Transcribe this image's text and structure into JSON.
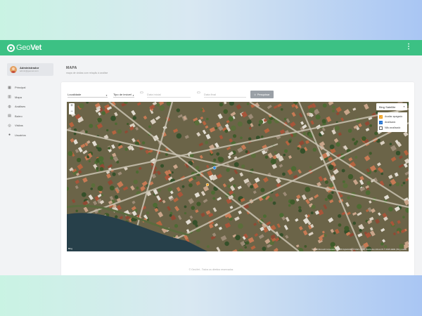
{
  "app": {
    "logo_main": "Geo",
    "logo_accent": "Vet"
  },
  "header": {
    "menu_icon": "more-vert-icon",
    "menu_glyph": "⋮"
  },
  "user": {
    "name": "Administrador",
    "email": "admin@geovet.com"
  },
  "sidebar": {
    "items": [
      {
        "label": "Principal",
        "icon": "dashboard-icon",
        "glyph": "▦"
      },
      {
        "label": "Mapa",
        "icon": "map-icon",
        "glyph": "▥"
      },
      {
        "label": "Análises",
        "icon": "globe-icon",
        "glyph": "◍"
      },
      {
        "label": "Bairro",
        "icon": "grid-icon",
        "glyph": "▤"
      },
      {
        "label": "Visitas",
        "icon": "location-icon",
        "glyph": "◎"
      },
      {
        "label": "Usuários",
        "icon": "users-icon",
        "glyph": "●"
      }
    ]
  },
  "page": {
    "title": "MAPA",
    "subtitle": "mapa de visitas com relação à análise"
  },
  "filters": {
    "localidade": "Localidade",
    "tipo_imovel": "Tipo de imóvel",
    "data_inicial_placeholder": "Data inicial",
    "data_final_placeholder": "Data final",
    "search_label": "Pesquisar",
    "search_glyph": "🔍"
  },
  "map": {
    "layer_select": "Bing Satellite",
    "layers": [
      {
        "label": "Avaliar apagado",
        "checked": true,
        "color": "#f0a020"
      },
      {
        "label": "Analisado",
        "checked": true,
        "color": "#1f6fd0"
      },
      {
        "label": "Não analisado",
        "checked": false,
        "color": "#ffffff"
      }
    ],
    "zoom_in": "+",
    "zoom_out": "−",
    "attribution": "© 2018 Microsoft Corporation © 2018 DigitalGlobe ©CNES (2018) Distribution Airbus DS © 2018 HERE | Bing Leaflet",
    "provider_logo": "Bing"
  },
  "footer": {
    "text": "© GeoVet - Todos os direitos reservados"
  },
  "colors": {
    "brand": "#3cc184",
    "water": "#27404a",
    "road": "#c9c2b1"
  }
}
